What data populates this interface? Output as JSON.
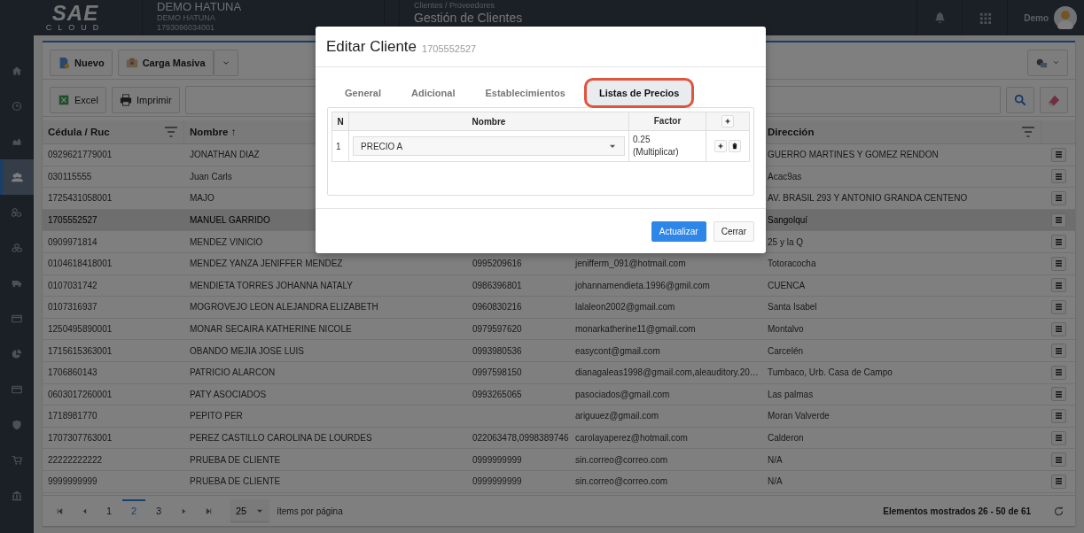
{
  "topbar": {
    "logo": "SAE",
    "logo_sub": "CLOUD",
    "company": {
      "name": "DEMO HATUNA",
      "subname": "DEMO HATUNA",
      "ruc": "1793096034001"
    },
    "breadcrumb": "Clientes / Proveedores",
    "page_title": "Gestión de Clientes",
    "user": "Demo"
  },
  "sidebar": {
    "items": [
      {
        "selected": false
      },
      {
        "selected": false
      },
      {
        "selected": false
      },
      {
        "selected": true
      },
      {
        "selected": false
      },
      {
        "selected": false
      },
      {
        "selected": false
      },
      {
        "selected": false
      },
      {
        "selected": false
      },
      {
        "selected": false
      },
      {
        "selected": false
      },
      {
        "selected": false
      },
      {
        "selected": false
      }
    ]
  },
  "toolbar": {
    "buttons": [
      "Nuevo",
      "Carga Masiva"
    ],
    "export_buttons": [
      "Excel",
      "Imprimir"
    ]
  },
  "table": {
    "columns": [
      {
        "label": "Cédula / Ruc",
        "filter": true
      },
      {
        "label": "Nombre ↑"
      },
      {
        "label": "Dirección",
        "filter": true
      }
    ],
    "rows": [
      {
        "cedula": "0929621779001",
        "nombre": "JONATHAN DIAZ",
        "direccion": "GUERRO MARTINES Y GOMEZ RENDON",
        "selected": false
      },
      {
        "cedula": "030115555",
        "nombre": "Juan Carls",
        "direccion": "Acac9as",
        "selected": false
      },
      {
        "cedula": "1725431058001",
        "nombre": "MAJO",
        "direccion": "AV. BRASIL 293 Y ANTONIO GRANDA CENTENO",
        "selected": false
      },
      {
        "cedula": "1705552527",
        "nombre": "MANUEL GARRIDO",
        "direccion": "Sangolquí",
        "selected": true
      },
      {
        "cedula": "0909971814",
        "nombre": "MENDEZ VINICIO",
        "direccion": "25 y la Q",
        "selected": false
      },
      {
        "cedula": "0104618418001",
        "nombre": "MENDEZ YANZA JENIFFER MENDEZ",
        "column_3": "0995209616",
        "column_4": "jenifferm_091@hotmail.com",
        "direccion": "Totoracocha",
        "selected": false
      },
      {
        "cedula": "0107031742",
        "nombre": "MENDIETA TORRES JOHANNA NATALY",
        "column_3": "0986396801",
        "column_4": "johannamendieta.1996@gmil.com",
        "direccion": "CUENCA",
        "selected": false
      },
      {
        "cedula": "0107316937",
        "nombre": "MOGROVEJO LEON ALEJANDRA ELIZABETH",
        "column_3": "0960830216",
        "column_4": "lalaleon2002@gmail.com",
        "direccion": "Santa Isabel",
        "selected": false
      },
      {
        "cedula": "1250495890001",
        "nombre": "MONAR SECAIRA KATHERINE NICOLE",
        "column_3": "0979597620",
        "column_4": "monarkatherine11@gmail.com",
        "direccion": "Montalvo",
        "selected": false
      },
      {
        "cedula": "1715615363001",
        "nombre": "OBANDO MEJÍA JOSÉ LUIS",
        "column_3": "0993980536",
        "column_4": "easycont@gmail.com",
        "direccion": "Carcelén",
        "selected": false
      },
      {
        "cedula": "1706860143",
        "nombre": "PATRICIO ALARCON",
        "column_3": "0997598150",
        "column_4": "dianagaleas1998@gmail.com,aleauditory.20…",
        "direccion": "Tumbaco, Urb. Casa de Campo",
        "selected": false
      },
      {
        "cedula": "0603017260001",
        "nombre": "PATY ASOCIADOS",
        "column_3": "0993265065",
        "column_4": "pasociados@gmail.com",
        "direccion": "Las palmas",
        "selected": false
      },
      {
        "cedula": "1718981770",
        "nombre": "PEPITO PER",
        "column_4": "ariguuez@gmail.com",
        "direccion": "Moran Valverde",
        "selected": false
      },
      {
        "cedula": "1707307763001",
        "nombre": "PEREZ CASTILLO CAROLINA DE LOURDES",
        "column_3": "022063478,0998389746",
        "column_4": "carolayaperez@hotmail.com",
        "direccion": "Calderon",
        "selected": false
      },
      {
        "cedula": "22222222222",
        "nombre": "PRUEBA DE CLIENTE",
        "column_3": "0999999999",
        "column_4": "sin.correo@correo.com",
        "direccion": "N/A",
        "selected": false
      },
      {
        "cedula": "9999999999",
        "nombre": "PRUEBA DE CLIENTE",
        "column_3": "0999999999",
        "column_4": "sin.correo@correo.com",
        "direccion": "N/A",
        "selected": false
      }
    ]
  },
  "pagination": {
    "pages": [
      {
        "label": "1",
        "selected": false
      },
      {
        "label": "2",
        "selected": true
      },
      {
        "label": "3",
        "selected": false
      }
    ],
    "page_size": "25",
    "page_size_label": "ítems por página",
    "summary": "Elementos mostrados 26 - 50 de 61"
  },
  "dialog": {
    "title": "Editar Cliente",
    "subtitle": "1705552527",
    "tabs": [
      {
        "label": "General",
        "selected": false
      },
      {
        "label": "Adicional",
        "selected": false
      },
      {
        "label": "Establecimientos",
        "selected": false
      },
      {
        "label": "Listas de Precios",
        "selected": true
      }
    ],
    "price_table": {
      "columns": [
        "N",
        "Nombre",
        "Factor"
      ],
      "rows": [
        {
          "n": "1",
          "nombre": "PRECIO A",
          "factor": "0.25 (Multiplicar)"
        }
      ]
    },
    "buttons": [
      {
        "label": "Actualizar",
        "kind": "primary"
      },
      {
        "label": "Cerrar",
        "kind": "default"
      }
    ]
  }
}
